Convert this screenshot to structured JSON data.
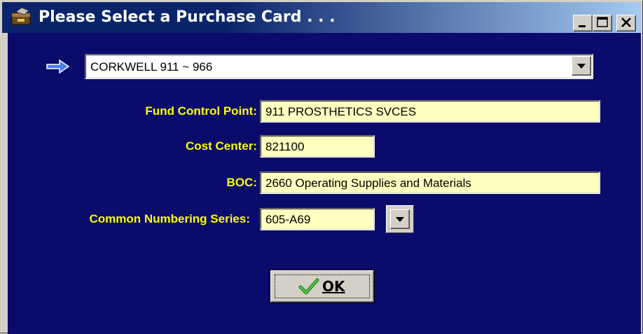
{
  "window": {
    "title": "Please Select a Purchase Card . . .",
    "title_bar_color": "#0a246a",
    "client_background": "#0b0b6b",
    "label_color": "#ffff00",
    "field_background": "#ffffc0"
  },
  "title_controls": {
    "minimize_icon": "minimize-icon",
    "maximize_icon": "maximize-icon",
    "close_icon": "close-icon"
  },
  "card_select": {
    "pointer_icon": "right-arrow-icon",
    "selected_value": "CORKWELL 911 ~ 966"
  },
  "fields": {
    "fund_control_point": {
      "label": "Fund Control Point:",
      "value": "911 PROSTHETICS SVCES"
    },
    "cost_center": {
      "label": "Cost Center:",
      "value": "821100"
    },
    "boc": {
      "label": "BOC:",
      "value": "2660 Operating Supplies and Materials"
    },
    "common_numbering_series": {
      "label": "Common Numbering Series:",
      "value": "605-A69"
    }
  },
  "ok_button": {
    "label": "OK",
    "icon": "checkmark-icon"
  }
}
